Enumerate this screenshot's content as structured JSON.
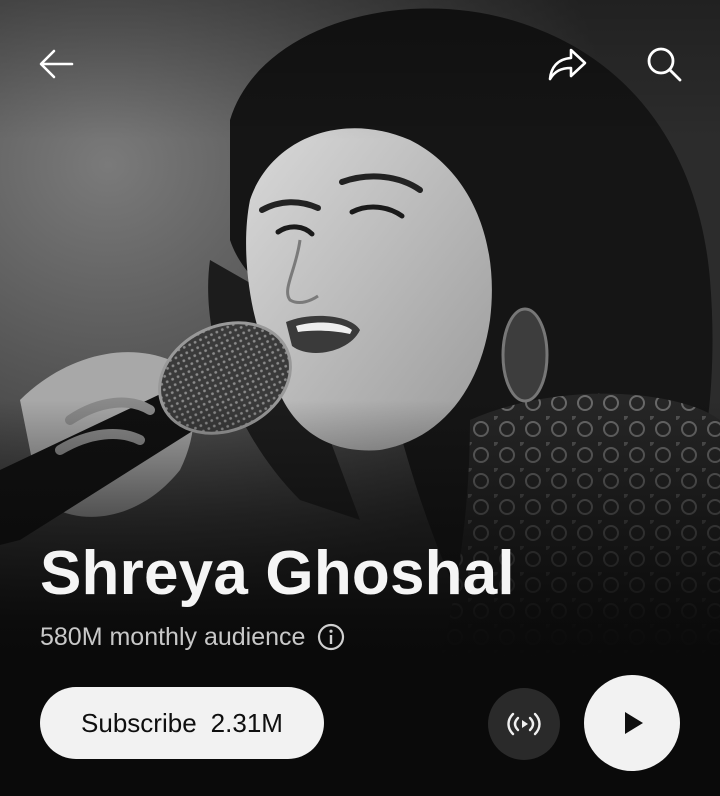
{
  "header": {
    "back_icon": "arrow-left-icon",
    "share_icon": "share-arrow-icon",
    "search_icon": "search-icon"
  },
  "artist": {
    "name": "Shreya Ghoshal",
    "audience": "580M monthly audience",
    "info_icon": "info-circle-icon",
    "photo": "artist-photo-monochrome"
  },
  "actions": {
    "subscribe_label": "Subscribe",
    "subscriber_count": "2.31M",
    "radio_icon": "radio-broadcast-icon",
    "play_icon": "play-icon"
  },
  "colors": {
    "background": "#0a0a0a",
    "primary_text": "#f5f5f5",
    "secondary_text": "#c8c8c8",
    "button_light": "#f2f2f2",
    "button_dark": "#2a2a2a"
  }
}
